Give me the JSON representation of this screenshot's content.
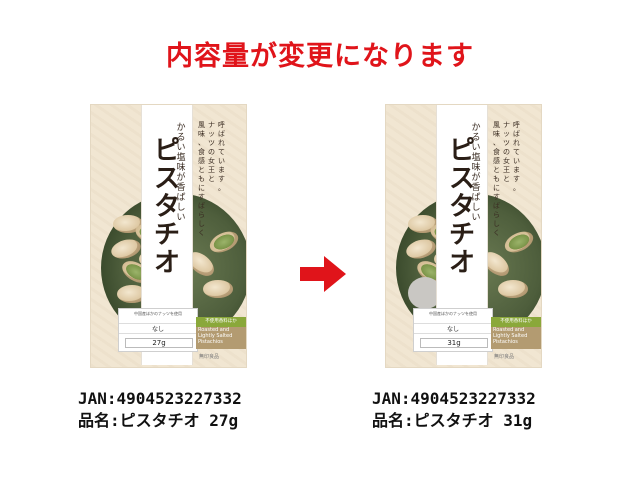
{
  "headline": "内容量が変更になります",
  "package": {
    "title": "ピスタチオ",
    "subtitle": "かるい塩味が香ばしい",
    "description": "風味、食感ともにすばらしくナッツの女王と呼ばれています。",
    "label_top": "中国産ほかのナッツを使用",
    "label_mid": "なし",
    "green_strip": "不使用香料ほか",
    "tan_strip": "Roasted and Lightly Salted Pistachios",
    "brand": "無印良品"
  },
  "before": {
    "weight_label": "27g",
    "jan": "JAN:4904523227332",
    "name_line": "品名:ピスタチオ 27g"
  },
  "after": {
    "weight_label": "31g",
    "jan": "JAN:4904523227332",
    "name_line": "品名:ピスタチオ 31g"
  },
  "colors": {
    "headline": "#e0141a",
    "arrow": "#e0141a"
  }
}
